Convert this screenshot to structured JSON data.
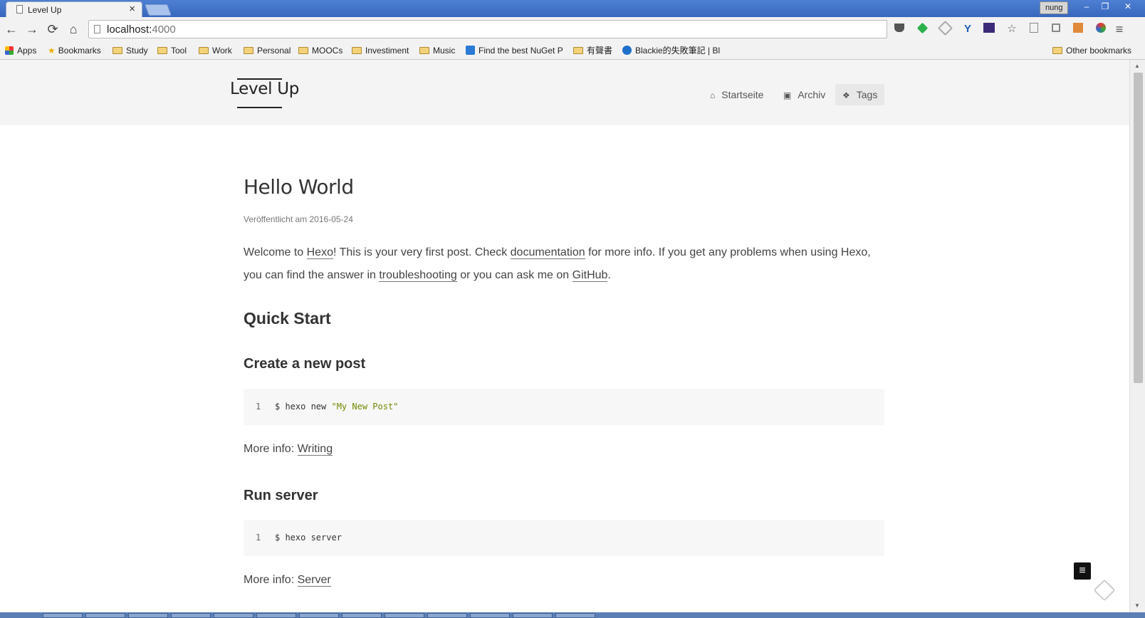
{
  "window": {
    "tab_title": "Level Up",
    "tab_close": "×",
    "user": "nung",
    "controls": [
      "–",
      "❐",
      "✕"
    ]
  },
  "toolbar": {
    "back": "←",
    "forward": "→",
    "reload": "⟳",
    "home": "⌂",
    "url_host": "localhost:",
    "url_port": "4000",
    "star": "☆",
    "menu": "≡"
  },
  "bookmarks": {
    "items": [
      "Apps",
      "Bookmarks",
      "Study",
      "Tool",
      "Work",
      "Personal",
      "MOOCs",
      "Investiment",
      "Music",
      "Find the best NuGet P",
      "有聲書",
      "Blackie的失敗筆記 | Bl"
    ],
    "other": "Other bookmarks"
  },
  "site": {
    "logo": "Level Up",
    "nav": [
      {
        "label": "Startseite",
        "icon": "⌂"
      },
      {
        "label": "Archiv",
        "icon": "▣"
      },
      {
        "label": "Tags",
        "icon": "❖"
      }
    ]
  },
  "post": {
    "title": "Hello World",
    "meta": "Veröffentlicht am 2016-05-24",
    "intro": {
      "t1": "Welcome to ",
      "link_hexo": "Hexo",
      "t2": "! This is your very first post. Check ",
      "link_docs": "documentation",
      "t3": " for more info. If you get any problems when using Hexo, you can find the answer in ",
      "link_trouble": "troubleshooting",
      "t4": " or you can ask me on ",
      "link_github": "GitHub",
      "t5": "."
    },
    "quick_start": "Quick Start",
    "sections": [
      {
        "heading": "Create a new post",
        "line_no": "1",
        "cmd": "$ hexo new ",
        "cmd_str": "\"My New Post\"",
        "more_label": "More info: ",
        "more_link": "Writing"
      },
      {
        "heading": "Run server",
        "line_no": "1",
        "cmd": "$ hexo server",
        "cmd_str": "",
        "more_label": "More info: ",
        "more_link": "Server"
      }
    ]
  },
  "fab_menu": "≡"
}
